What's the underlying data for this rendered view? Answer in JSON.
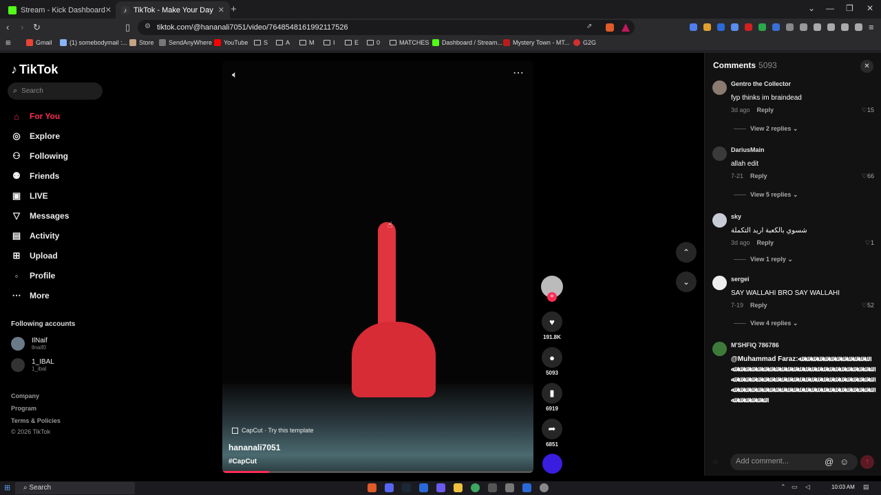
{
  "browser": {
    "tabs": [
      {
        "title": "Stream - Kick Dashboard",
        "active": false,
        "favicon_color": "#53fc18"
      },
      {
        "title": "TikTok - Make Your Day",
        "active": true,
        "favicon_color": "#ffffff"
      }
    ],
    "new_tab": "+",
    "url": "tiktok.com/@hananali7051/video/7648548161992117526",
    "bookmarks": [
      {
        "label": "Gmail",
        "icon": "gmail-icon"
      },
      {
        "label": "(1) somebodymail :...",
        "icon": "site-icon"
      },
      {
        "label": "Store",
        "icon": "store-icon"
      },
      {
        "label": "SendAnyWhere",
        "icon": "send-icon"
      },
      {
        "label": "YouTube",
        "icon": "youtube-icon"
      },
      {
        "label": "S",
        "icon": "folder-icon"
      },
      {
        "label": "A",
        "icon": "folder-icon"
      },
      {
        "label": "M",
        "icon": "folder-icon"
      },
      {
        "label": "I",
        "icon": "folder-icon"
      },
      {
        "label": "E",
        "icon": "folder-icon"
      },
      {
        "label": "0",
        "icon": "folder-icon"
      },
      {
        "label": "MATCHES",
        "icon": "folder-icon"
      },
      {
        "label": "Dashboard / Stream...",
        "icon": "kick-icon"
      },
      {
        "label": "Mystery Town - MT...",
        "icon": "site-icon"
      },
      {
        "label": "G2G",
        "icon": "g2g-icon"
      }
    ]
  },
  "sidebar": {
    "brand": "TikTok",
    "search_placeholder": "Search",
    "nav": [
      {
        "label": "For You",
        "icon": "home-icon",
        "glyph": "⌂",
        "active": true
      },
      {
        "label": "Explore",
        "icon": "compass-icon",
        "glyph": "◎",
        "active": false
      },
      {
        "label": "Following",
        "icon": "following-icon",
        "glyph": "⚇",
        "active": false
      },
      {
        "label": "Friends",
        "icon": "friends-icon",
        "glyph": "⚉",
        "active": false
      },
      {
        "label": "LIVE",
        "icon": "live-icon",
        "glyph": "▣",
        "active": false
      },
      {
        "label": "Messages",
        "icon": "messages-icon",
        "glyph": "▽",
        "active": false
      },
      {
        "label": "Activity",
        "icon": "activity-icon",
        "glyph": "▤",
        "active": false
      },
      {
        "label": "Upload",
        "icon": "upload-icon",
        "glyph": "⊞",
        "active": false
      },
      {
        "label": "Profile",
        "icon": "profile-icon",
        "glyph": "◦",
        "active": false
      },
      {
        "label": "More",
        "icon": "more-icon",
        "glyph": "⋯",
        "active": false
      }
    ],
    "following_title": "Following accounts",
    "following": [
      {
        "name": "IlNaif",
        "handle": "llnaif0"
      },
      {
        "name": "1_IBAL",
        "handle": "1_ibal"
      }
    ],
    "footer": [
      "Company",
      "Program",
      "Terms & Policies",
      "© 2026 TikTok"
    ]
  },
  "video": {
    "capcut": "CapCut · Try this template",
    "username": "hananali7051",
    "hashtag": "#CapCut",
    "progress": 0.15
  },
  "actions": {
    "likes": "191.8K",
    "comments": "5093",
    "saves": "6919",
    "shares": "6851"
  },
  "comments": {
    "title": "Comments",
    "count": "5093",
    "items": [
      {
        "user": "Gentro the Collector",
        "text": "fyp thinks im braindead",
        "time": "3d ago",
        "reply": "Reply",
        "likes": "15",
        "view_replies": "View 2 replies"
      },
      {
        "user": "DariusMain",
        "text": "allah edit",
        "time": "7-21",
        "reply": "Reply",
        "likes": "66",
        "view_replies": "View 5 replies"
      },
      {
        "user": "sky",
        "text": "شسوي بالكعبة اريد التكملة",
        "time": "3d ago",
        "reply": "Reply",
        "likes": "1",
        "view_replies": "View 1 reply"
      },
      {
        "user": "sergei",
        "text": "SAY WALLAHI BRO SAY WALLAHI",
        "time": "7-19",
        "reply": "Reply",
        "likes": "52",
        "view_replies": "View 4 replies"
      },
      {
        "user": "M'SHFIQ 786786",
        "text": "@Muhammad Faraz:ﷲ ﷲ ﷲ ﷲ ﷲ ﷲ ﷲ ﷲ ﷲ ﷲ ﷲ ﷲ ﷲ ﷲ ﷲ ﷲ ﷲ ﷲ ﷲ ﷲ ﷲ ﷲ ﷲ ﷲ ﷲ ﷲ ﷲ ﷲ ﷲ ﷲ ﷲ ﷲ ﷲ ﷲ ﷲ ﷲ ﷲ ﷲ ﷲ ﷲ ﷲ ﷲ ﷲ ﷲ ﷲ ﷲ ﷲ ﷲ ﷲ ﷲ ﷲ ﷲ ﷲ ﷲ ﷲ ﷲ ﷲ ﷲ ﷲ ﷲ ﷲ ﷲ ﷲ ﷲ ﷲ ﷲ ﷲ ﷲ ﷲ ﷲ ﷲ ﷲ ﷲ ﷲ ﷲ ﷲ ﷲ ﷲ ﷲ ﷲ ﷲ ﷲ ﷲ ﷲ ﷲ ﷲ ﷲ ﷲ ﷲ ﷲ"
      }
    ],
    "input_placeholder": "Add comment..."
  },
  "taskbar": {
    "search": "Search",
    "time": "10:03 AM"
  },
  "colors": {
    "accent": "#fe2c55",
    "background": "#000000",
    "panel": "#121212"
  }
}
